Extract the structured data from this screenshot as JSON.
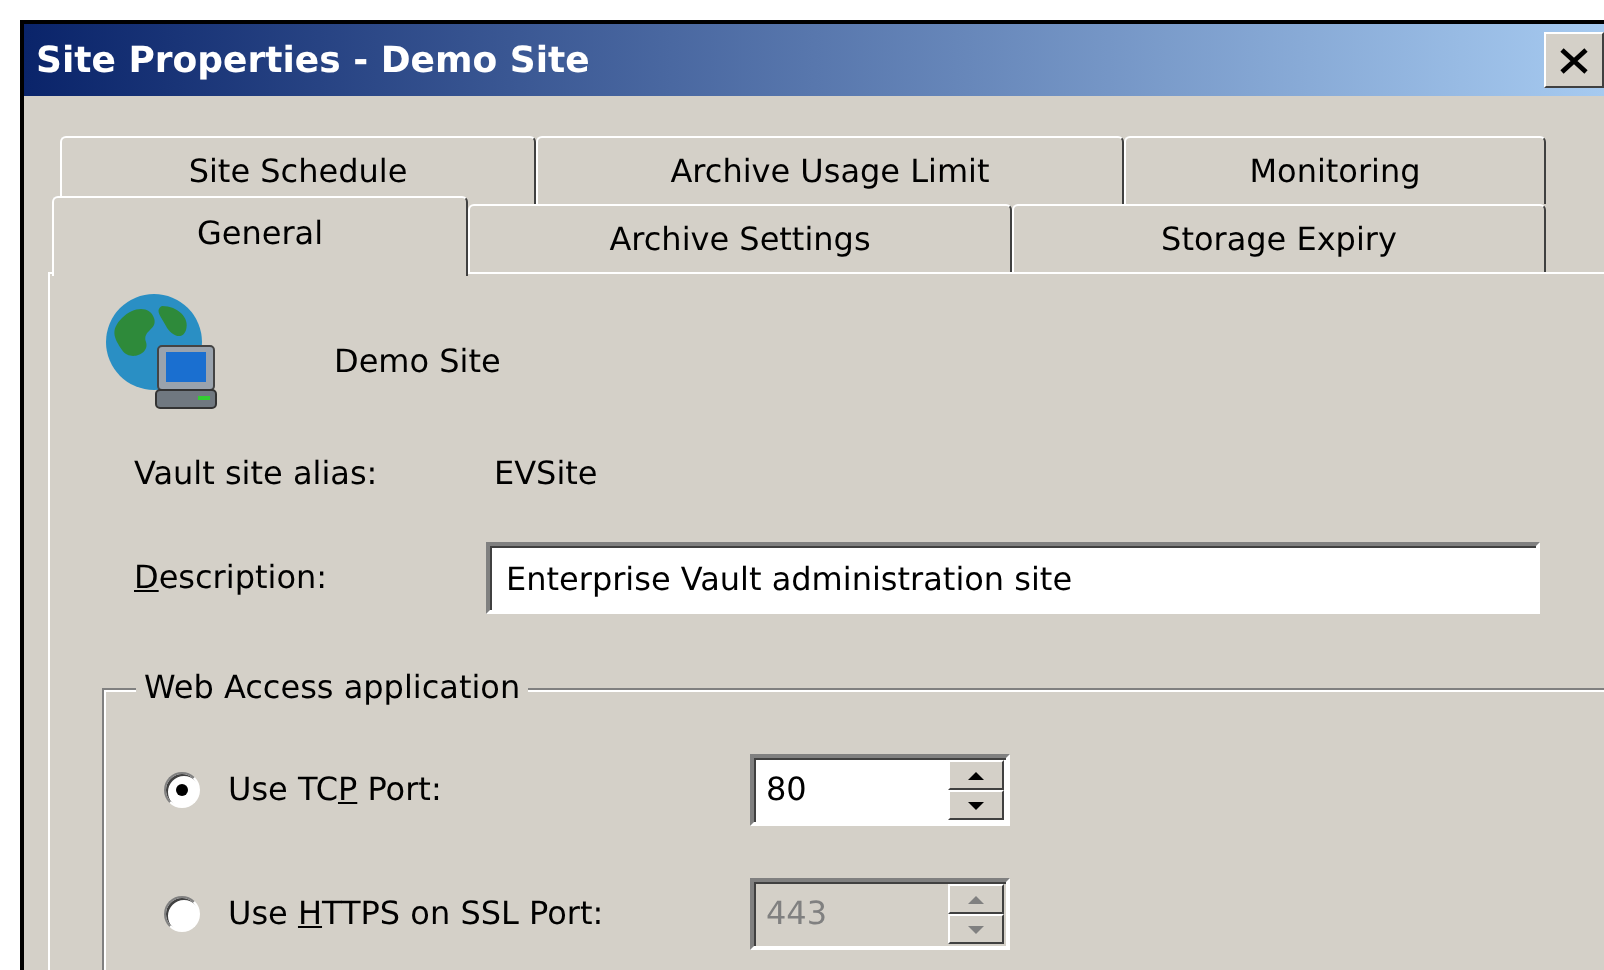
{
  "window": {
    "title": "Site Properties - Demo Site"
  },
  "tab_rows": [
    {
      "tabs": [
        {
          "label": "Site Schedule",
          "selected": false
        },
        {
          "label": "Archive Usage Limit",
          "selected": false
        },
        {
          "label": "Monitoring",
          "selected": false
        }
      ]
    },
    {
      "tabs": [
        {
          "label": "General",
          "selected": true
        },
        {
          "label": "Archive Settings",
          "selected": false
        },
        {
          "label": "Storage Expiry",
          "selected": false
        }
      ]
    }
  ],
  "site": {
    "name": "Demo Site"
  },
  "alias": {
    "label": "Vault site alias:",
    "value": "EVSite"
  },
  "description": {
    "label": {
      "key": "D",
      "post": "escription:"
    },
    "value": "Enterprise Vault administration site"
  },
  "web_access": {
    "legend": "Web Access application",
    "options": [
      {
        "label": {
          "pre": "Use TC",
          "key": "P",
          "post": " Port:"
        },
        "selected": true,
        "port": "80",
        "disabled": false
      },
      {
        "label": {
          "pre": "Use ",
          "key": "H",
          "post": "TTPS on SSL Port:"
        },
        "selected": false,
        "port": "443",
        "disabled": true
      }
    ]
  }
}
